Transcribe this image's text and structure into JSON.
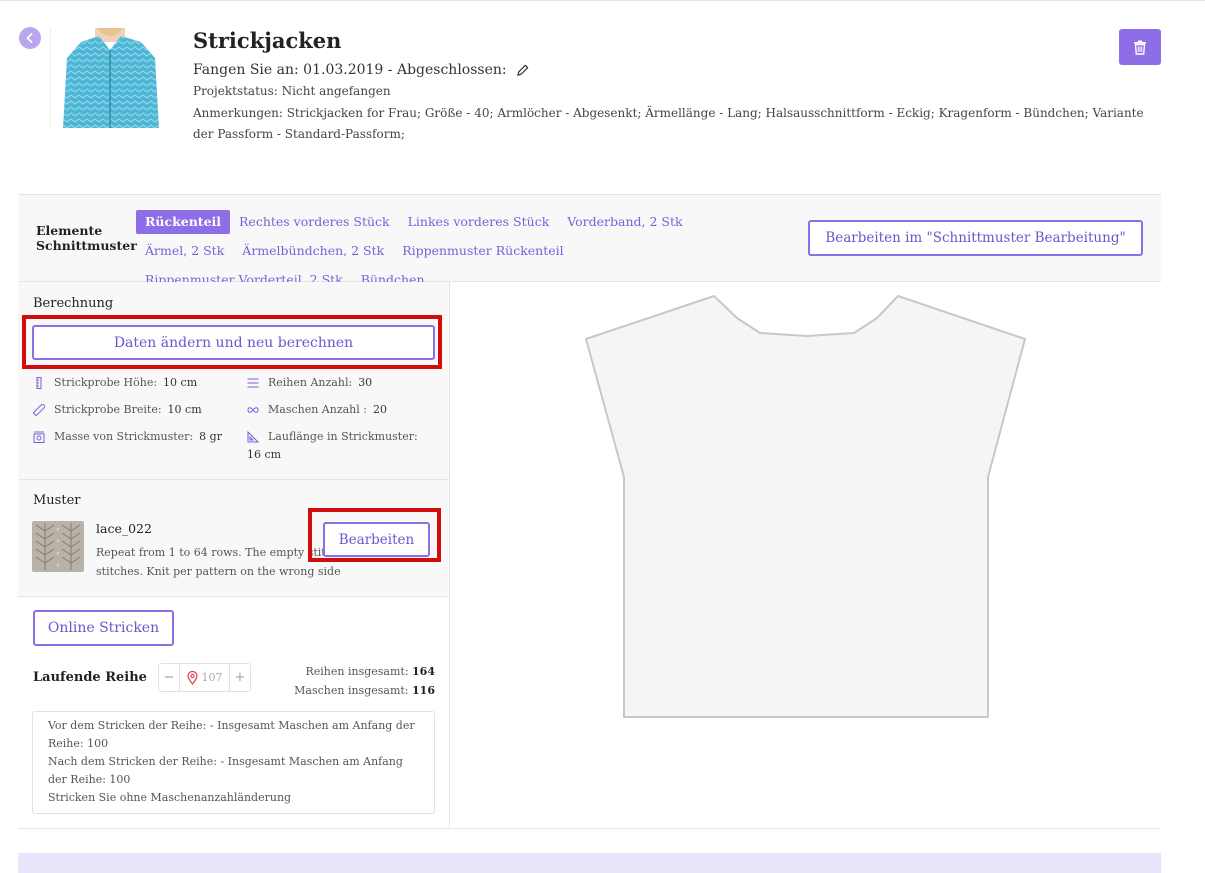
{
  "project": {
    "title": "Strickjacken",
    "dates": "Fangen Sie an: 01.03.2019 - Abgeschlossen:",
    "status": "Projektstatus: Nicht angefangen",
    "notes": "Anmerkungen: Strickjacken for Frau; Größe - 40; Armlöcher - Abgesenkt; Ärmellänge - Lang; Halsausschnittform - Eckig; Kragenform - Bündchen; Variante der Passform - Standard-Passform;"
  },
  "elements": {
    "label_line1": "Elemente",
    "label_line2": "Schnittmuster",
    "tabs": [
      "Rückenteil",
      "Rechtes vorderes Stück",
      "Linkes vorderes Stück",
      "Vorderband, 2 Stk",
      "Ärmel, 2 Stk",
      "Ärmelbündchen, 2 Stk",
      "Rippenmuster Rückenteil",
      "Rippenmuster Vorderteil, 2 Stk",
      "Bündchen"
    ],
    "active_tab": "Rückenteil",
    "edit_button": "Bearbeiten im \"Schnittmuster Bearbeitung\""
  },
  "calculation": {
    "title": "Berechnung",
    "recalc_button": "Daten ändern und neu berechnen",
    "gauge_height_label": "Strickprobe Höhe:",
    "gauge_height_value": "10 cm",
    "rows_label": "Reihen Anzahl:",
    "rows_value": "30",
    "gauge_width_label": "Strickprobe Breite:",
    "gauge_width_value": "10 cm",
    "stitches_label": "Maschen Anzahl :",
    "stitches_value": "20",
    "weight_label": "Masse von Strickmuster:",
    "weight_value": "8 gr",
    "yarn_length_label": "Lauflänge in Strickmuster:",
    "yarn_length_value": "16 cm"
  },
  "muster": {
    "title": "Muster",
    "name": "lace_022",
    "description": "Repeat from 1 to 64 rows. The empty stitches are the knit stitches. Knit per pattern on the wrong side",
    "edit_button": "Bearbeiten"
  },
  "knitting": {
    "online_button": "Online Stricken",
    "current_row_label": "Laufende Reihe",
    "current_row_value": "107",
    "minus": "−",
    "plus": "+",
    "rows_total_label": "Reihen insgesamt:",
    "rows_total_value": "164",
    "stitches_total_label": "Maschen insgesamt:",
    "stitches_total_value": "116",
    "info_lines": [
      "Vor dem Stricken der Reihe: - Insgesamt Maschen am Anfang der Reihe: 100",
      "Nach dem Stricken der Reihe: - Insgesamt Maschen am Anfang der Reihe: 100",
      "Stricken Sie ohne Maschenanzahländerung"
    ]
  },
  "colors": {
    "accent": "#8e6ee6",
    "highlight_box": "#d10d0d",
    "panel_bg": "#f8f8f8",
    "bottom_band": "#e9e5fb"
  }
}
